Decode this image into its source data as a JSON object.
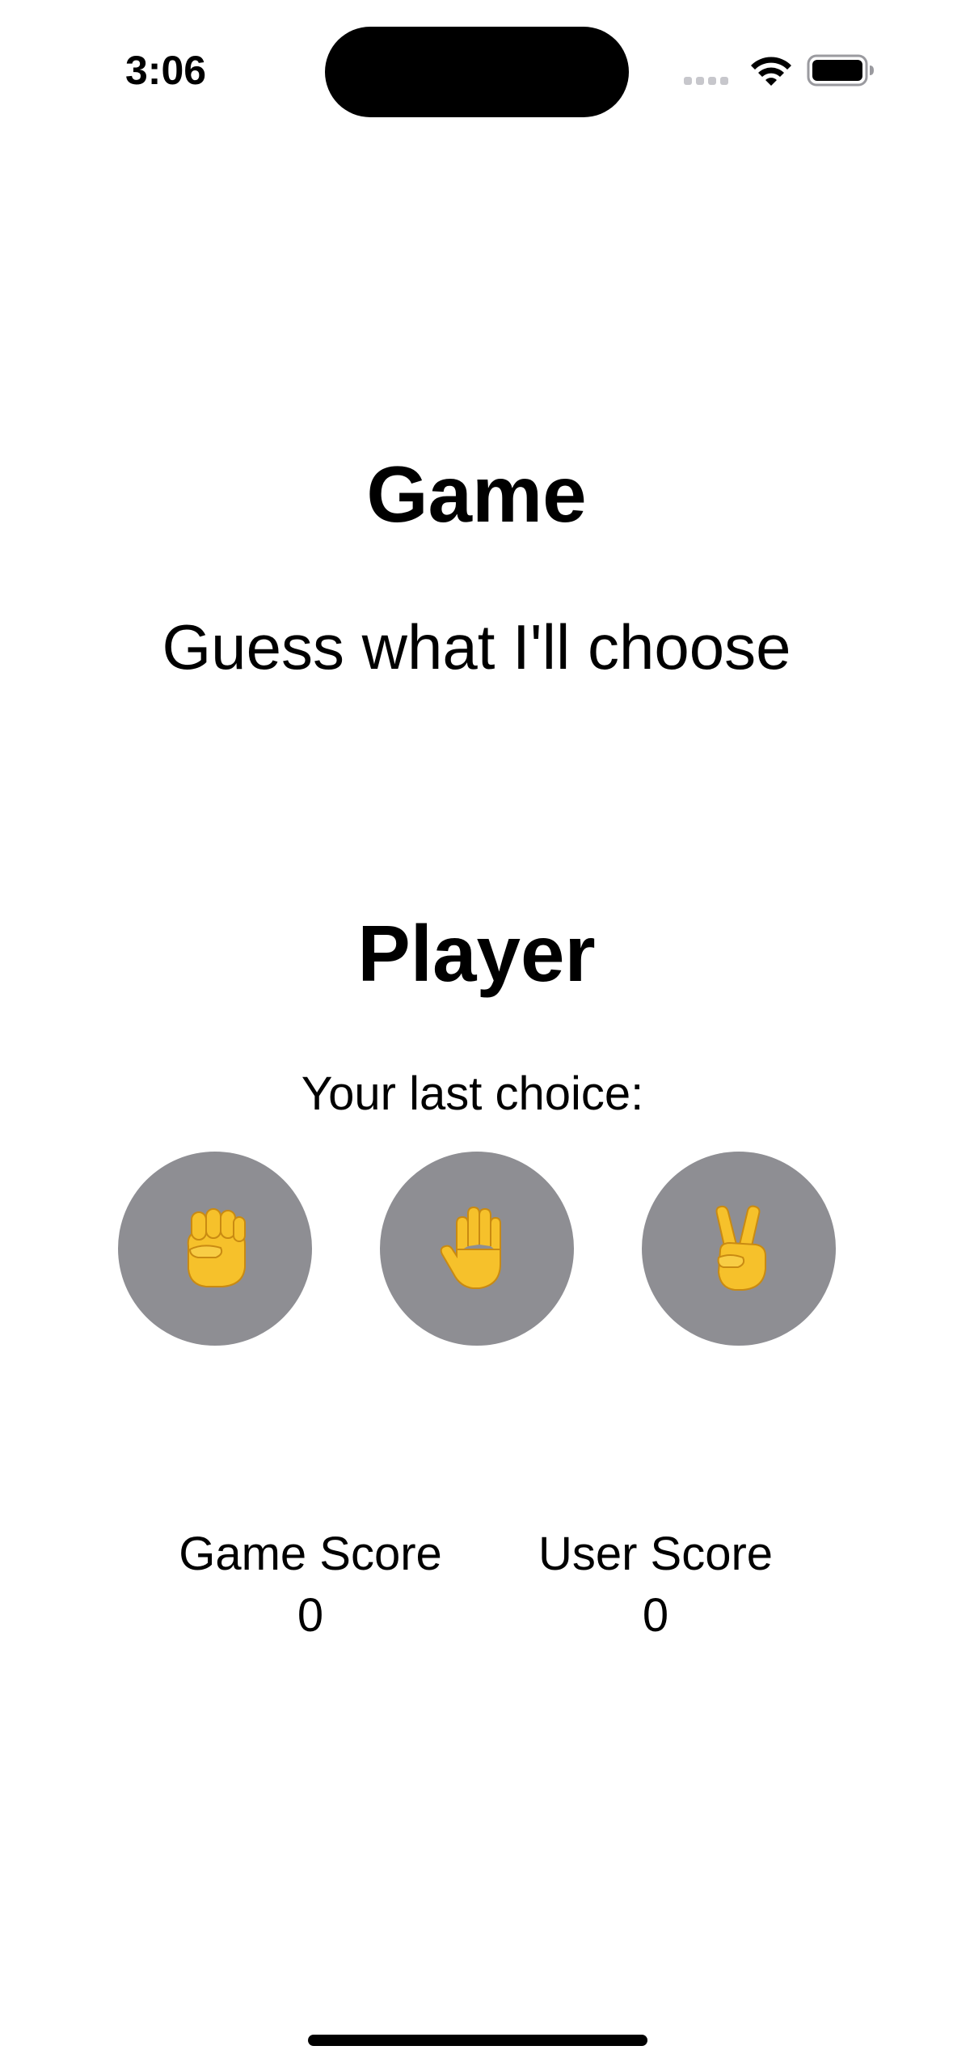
{
  "status_bar": {
    "time": "3:06",
    "icons": [
      "cellular-dots-icon",
      "wifi-icon",
      "battery-icon"
    ]
  },
  "game": {
    "title": "Game",
    "subtitle": "Guess what I'll choose"
  },
  "player": {
    "title": "Player",
    "last_choice_label": "Your last choice:",
    "choices": [
      {
        "name": "rock",
        "icon": "raised-fist-icon"
      },
      {
        "name": "paper",
        "icon": "raised-hand-icon"
      },
      {
        "name": "scissors",
        "icon": "victory-hand-icon"
      }
    ],
    "button_color": "#8e8e93",
    "emoji_color": "#f6c12b"
  },
  "scores": {
    "game_label": "Game Score",
    "game_value": "0",
    "user_label": "User Score",
    "user_value": "0"
  }
}
